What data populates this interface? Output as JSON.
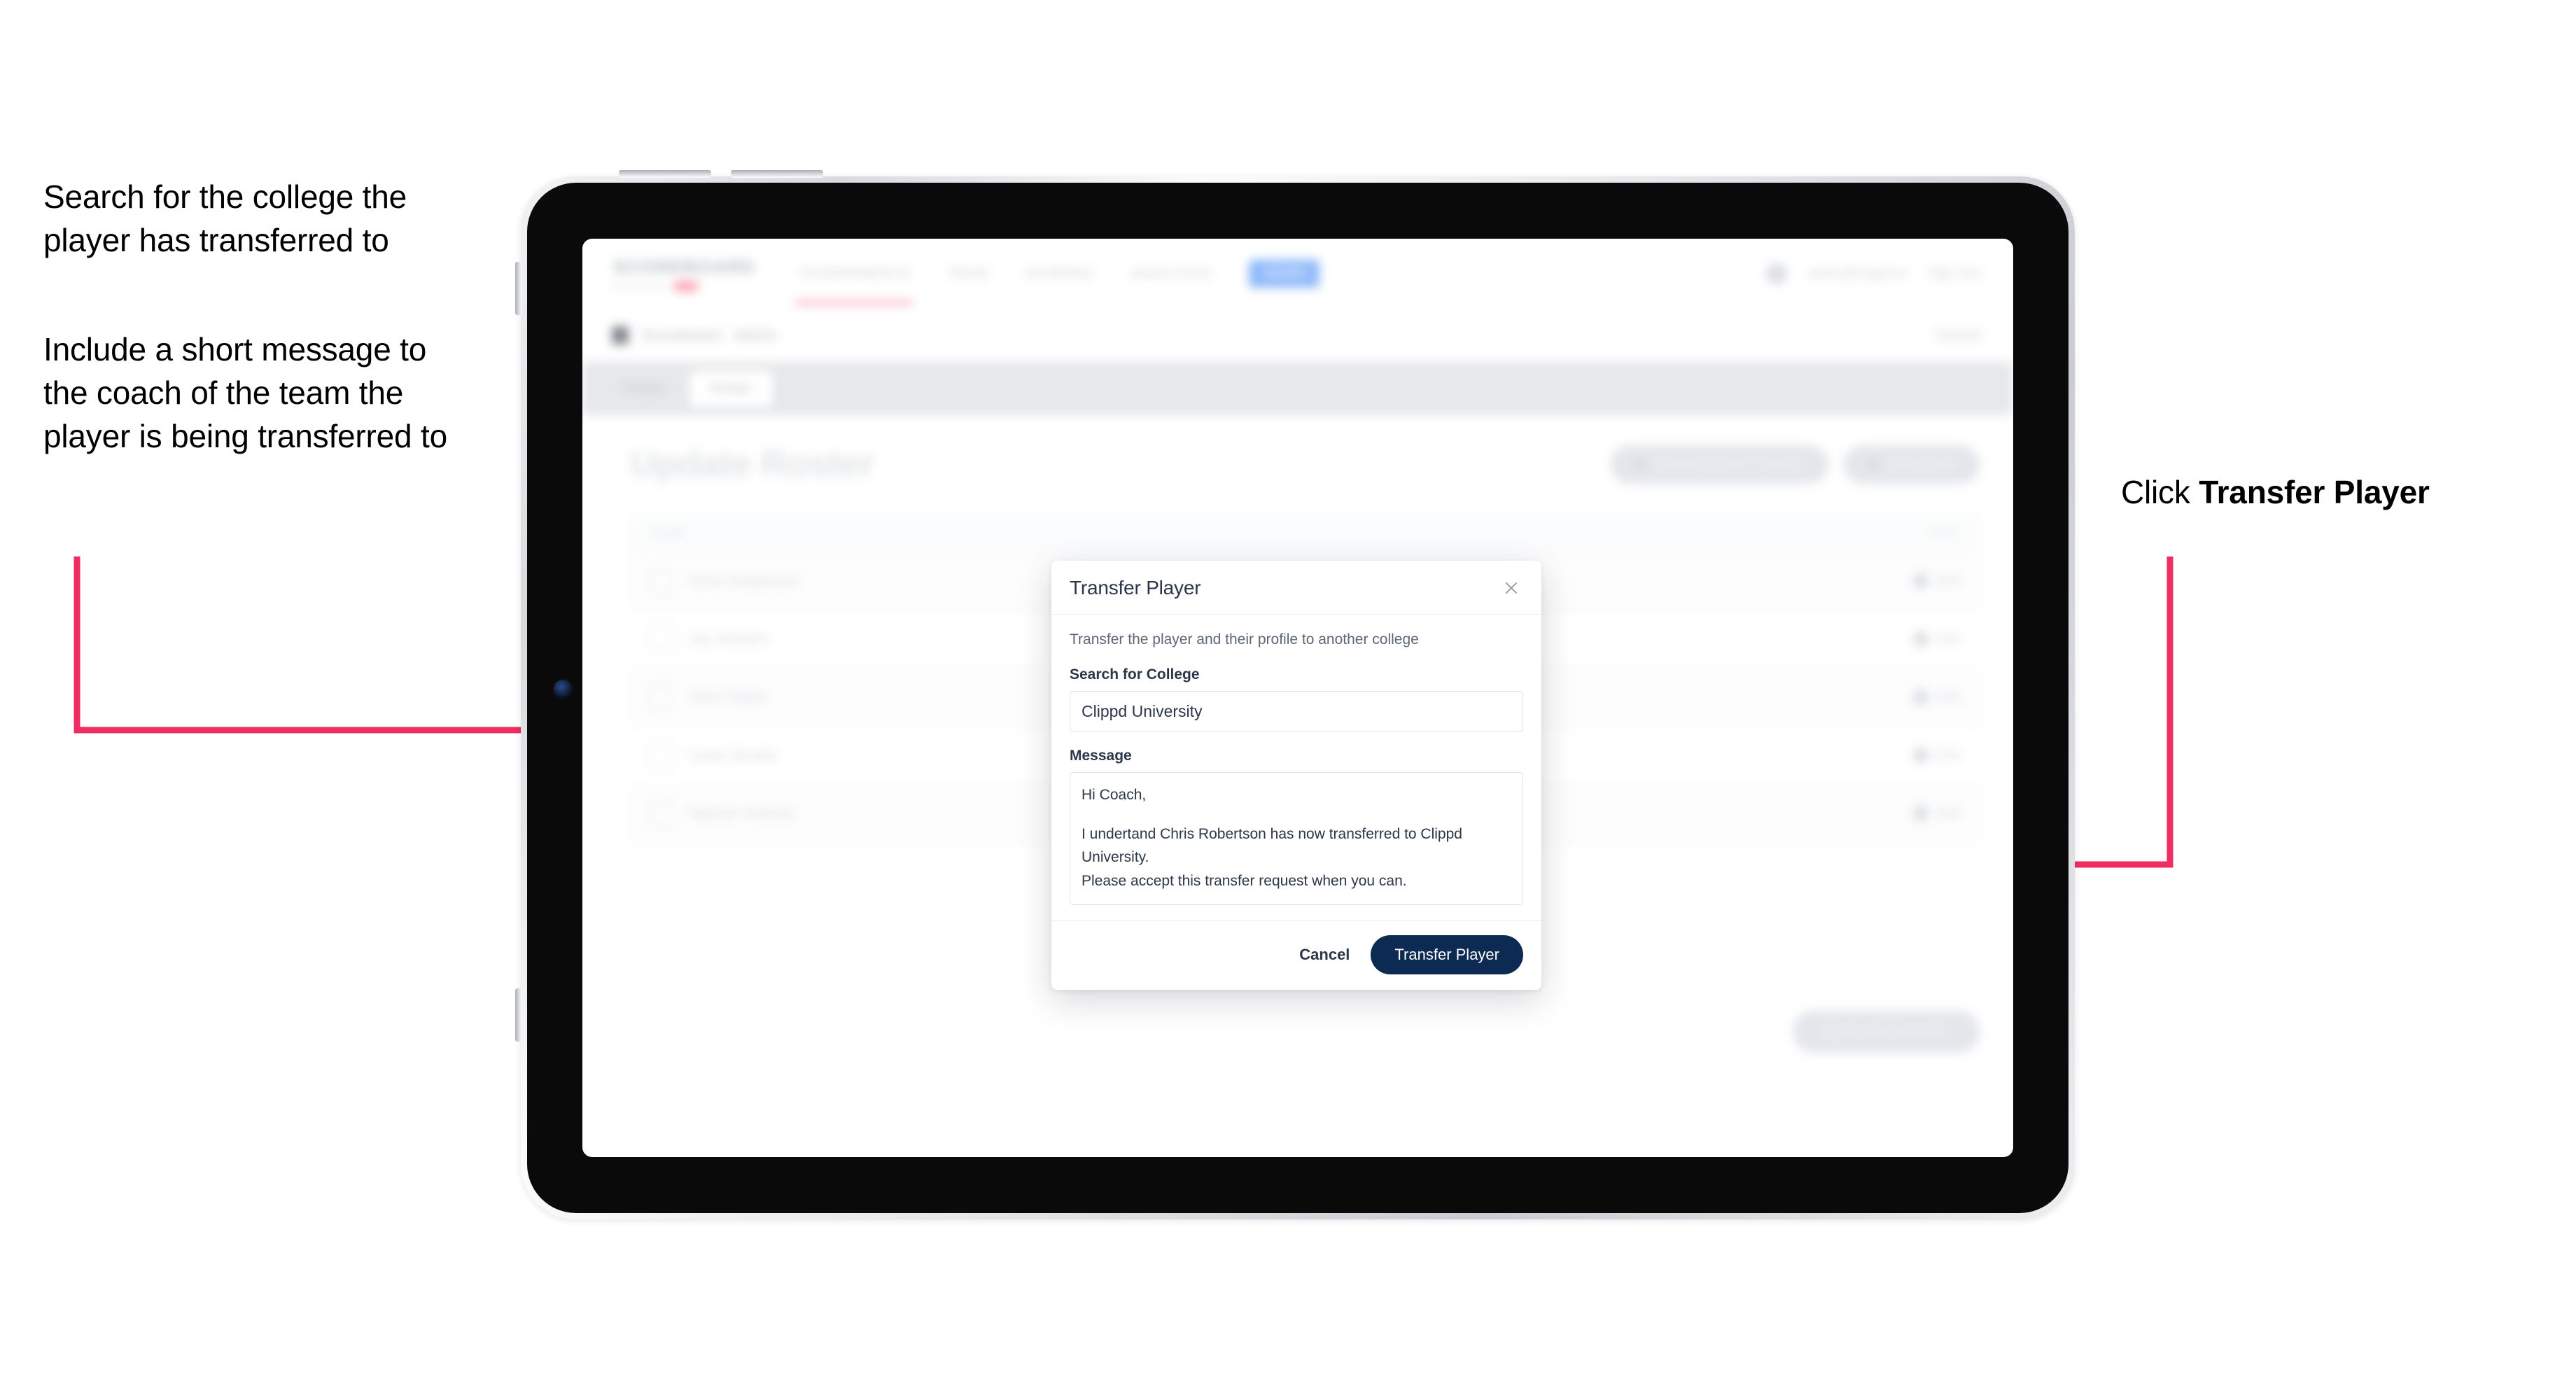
{
  "annotations": {
    "left_top": "Search for the college the player has transferred to",
    "left_bottom": "Include a short message to the coach of the team the player is being transferred to",
    "right_prefix": "Click ",
    "right_strong": "Transfer Player",
    "arrow_color": "#ef2d62"
  },
  "app": {
    "brand": {
      "word": "SCOREBOARD",
      "sub": "Powered by",
      "tag": ""
    },
    "nav_links": [
      "TOURNAMENTS",
      "TEAM",
      "SCORING",
      "ANALYTICS"
    ],
    "nav_pill": "ADMIN",
    "nav_user": "admin@clippd.io",
    "nav_signout": "Sign Out",
    "subbar": {
      "title": "Scoreboard",
      "subtitle": "Admin",
      "cancel": "Cancel"
    },
    "tabs": [
      {
        "label": "Details",
        "active": false
      },
      {
        "label": "Roster",
        "active": true
      }
    ],
    "page_title": "Update Roster",
    "actions": [
      {
        "label": "Request Player Transfer"
      },
      {
        "label": "Add Player"
      }
    ],
    "roster": {
      "col_name": "NAME",
      "col_edit": "EDIT",
      "edit_label": "Edit",
      "players": [
        "Chris Robertson",
        "Jay Winters",
        "John Taylor",
        "Lewis Brodie",
        "Nathan Holmes"
      ]
    },
    "save_button": "Save and Continue"
  },
  "modal": {
    "title": "Transfer Player",
    "close_icon": "close-icon",
    "description": "Transfer the player and their profile to another college",
    "college_label": "Search for College",
    "college_value": "Clippd University",
    "college_placeholder": "Search for College",
    "message_label": "Message",
    "message_line_1": "Hi Coach,",
    "message_line_2": "I undertand Chris Robertson has now transferred to Clippd University.",
    "message_line_3": "Please accept this transfer request when you can.",
    "cancel_label": "Cancel",
    "submit_label": "Transfer Player",
    "primary_color": "#0d2b52"
  }
}
